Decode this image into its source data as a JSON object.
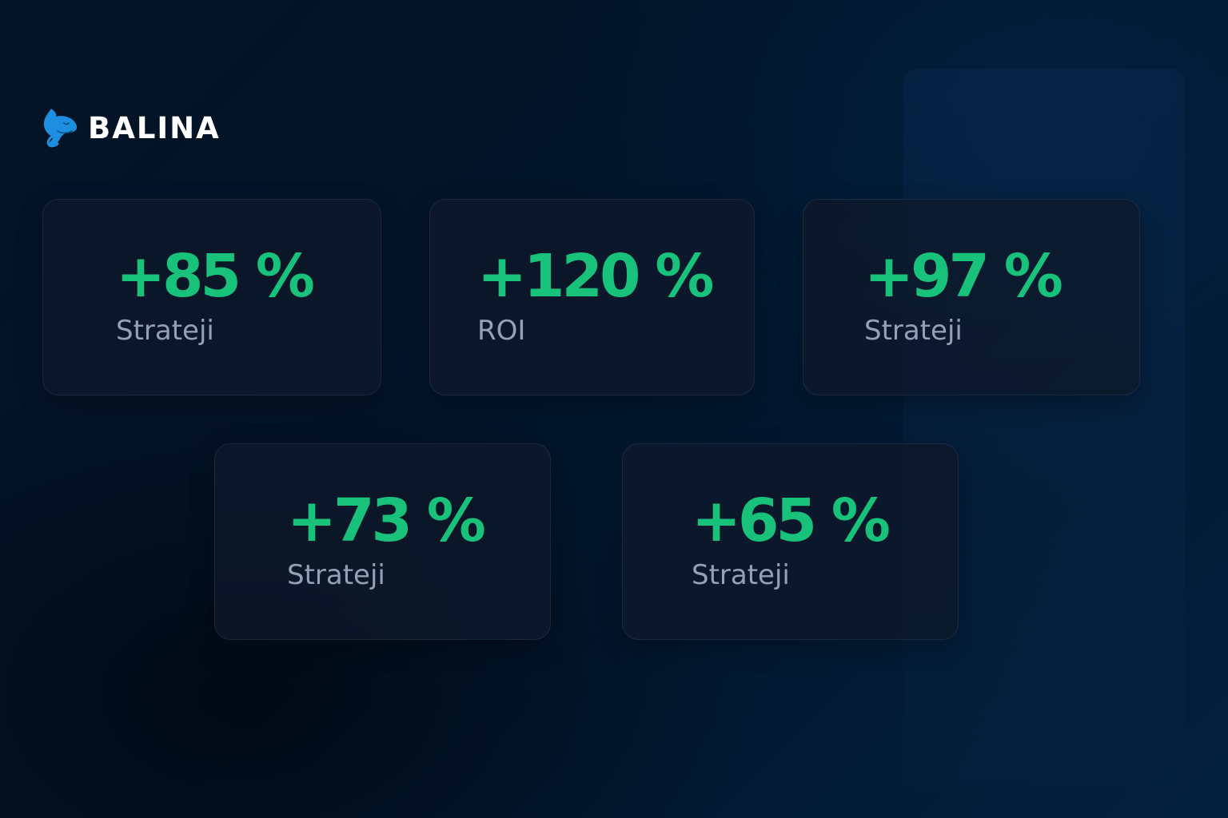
{
  "brand": {
    "name": "BALINA",
    "logo_icon": "whale-icon",
    "logo_color": "#1e8fe0"
  },
  "colors": {
    "accent_positive": "#19c27a",
    "label": "#93a1b6",
    "background": "#031a33"
  },
  "cards": [
    {
      "value": "+85 %",
      "label": "Strateji"
    },
    {
      "value": "+120 %",
      "label": "ROI"
    },
    {
      "value": "+97 %",
      "label": "Strateji"
    },
    {
      "value": "+73 %",
      "label": "Strateji"
    },
    {
      "value": "+65 %",
      "label": "Strateji"
    }
  ]
}
